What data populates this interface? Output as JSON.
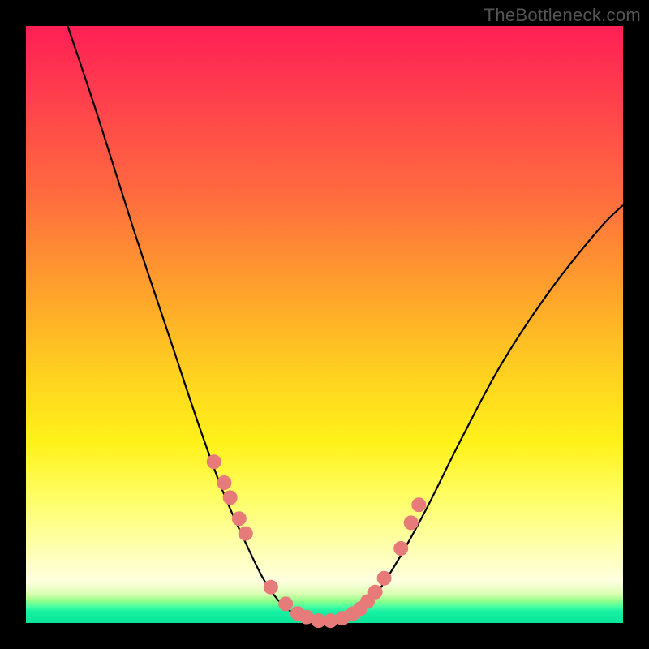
{
  "watermark": "TheBottleneck.com",
  "colors": {
    "dot": "#e77b7a",
    "curve": "#000000",
    "frame": "#000000"
  },
  "chart_data": {
    "type": "line",
    "title": "",
    "xlabel": "",
    "ylabel": "",
    "xlim": [
      0,
      100
    ],
    "ylim": [
      0,
      100
    ],
    "grid": false,
    "legend": false,
    "note": "No axis ticks or numeric labels are rendered; curve values are read as approximate percentages over a 0–100 × 0–100 plot area (0,0 at bottom-left).",
    "series": [
      {
        "name": "left-branch",
        "x": [
          7,
          12,
          18,
          24,
          29,
          33,
          37,
          40,
          43,
          46
        ],
        "y": [
          100,
          85,
          66,
          48,
          33,
          22,
          13,
          7,
          3,
          1
        ]
      },
      {
        "name": "valley",
        "x": [
          46,
          49,
          52,
          55
        ],
        "y": [
          1,
          0,
          0,
          1
        ]
      },
      {
        "name": "right-branch",
        "x": [
          55,
          58,
          62,
          67,
          73,
          80,
          88,
          96,
          100
        ],
        "y": [
          1,
          4,
          10,
          19,
          31,
          44,
          56,
          66,
          70
        ]
      }
    ],
    "dots": {
      "name": "markers",
      "x": [
        31.5,
        33.2,
        34.2,
        35.7,
        36.8,
        41.0,
        43.5,
        45.5,
        47.0,
        49.0,
        51.0,
        53.0,
        54.8,
        56.0,
        57.2,
        58.5,
        60.0,
        62.8,
        64.5,
        65.8
      ],
      "y": [
        27.0,
        23.5,
        21.0,
        17.5,
        15.0,
        6.0,
        3.2,
        1.6,
        1.0,
        0.4,
        0.4,
        0.8,
        1.6,
        2.4,
        3.6,
        5.2,
        7.5,
        12.5,
        16.8,
        19.8
      ]
    }
  }
}
